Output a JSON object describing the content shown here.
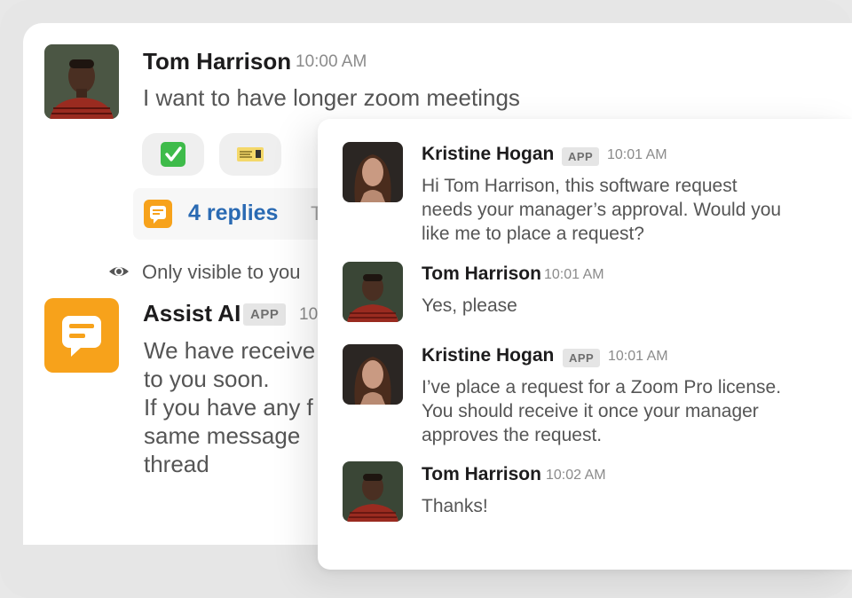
{
  "main": {
    "messages": [
      {
        "author": "Tom Harrison",
        "time": "10:00 AM",
        "text": "I want to have longer zoom meetings",
        "reactions": [
          {
            "icon": "checkmark-icon",
            "emoji": "✅"
          },
          {
            "icon": "ticket-icon",
            "emoji": "🎫"
          }
        ],
        "replies": {
          "count_label": "4 replies",
          "time_label": "Tod"
        }
      },
      {
        "visibility_note": "Only visible to you",
        "author": "Assist AI",
        "badge": "APP",
        "time": "10",
        "lines": [
          "We have receive",
          "to you soon.",
          "If you have any f",
          "same message",
          "thread"
        ]
      }
    ]
  },
  "thread": {
    "messages": [
      {
        "author": "Kristine Hogan",
        "badge": "APP",
        "time": "10:01 AM",
        "lines": [
          "Hi Tom Harrison, this software request",
          "needs your manager’s approval. Would you",
          "like me to place a request?"
        ]
      },
      {
        "author": "Tom Harrison",
        "time": "10:01 AM",
        "lines": [
          "Yes, please"
        ]
      },
      {
        "author": "Kristine Hogan",
        "badge": "APP",
        "time": "10:01 AM",
        "lines": [
          "I’ve place a request for a Zoom Pro license.",
          "You should receive it once your manager",
          "approves the request."
        ]
      },
      {
        "author": "Tom Harrison",
        "time": "10:02 AM",
        "lines": [
          "Thanks!"
        ]
      }
    ]
  },
  "colors": {
    "accent_orange": "#f7a21b",
    "link_blue": "#2a6ab3",
    "badge_bg": "#e5e5e5"
  }
}
